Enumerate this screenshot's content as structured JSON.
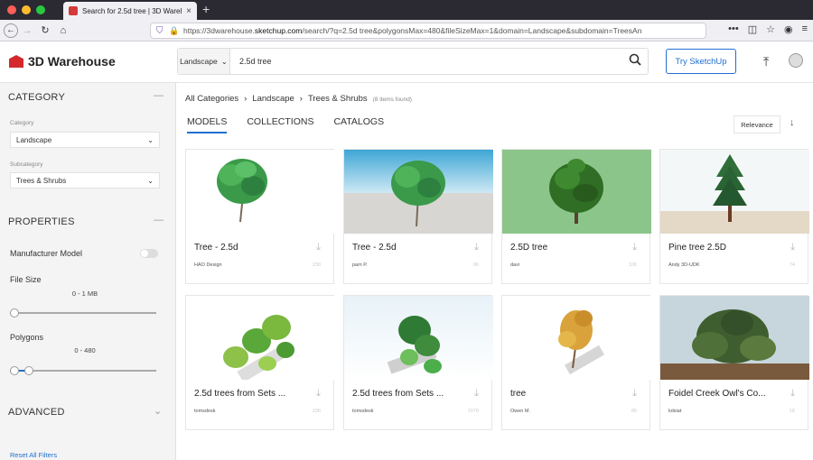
{
  "browser": {
    "tab_title": "Search for 2.5d tree | 3D Wareh",
    "url_prefix": "https://3dwarehouse.",
    "url_domain": "sketchup.com",
    "url_suffix": "/search/?q=2.5d tree&polygonsMax=480&fileSizeMax=1&domain=Landscape&subdomain=TreesAn"
  },
  "header": {
    "logo_text": "3D Warehouse",
    "search_category": "Landscape",
    "search_value": "2.5d tree",
    "try_label": "Try SketchUp"
  },
  "sidebar": {
    "category_title": "CATEGORY",
    "category_label": "Category",
    "category_value": "Landscape",
    "subcategory_label": "Subcategory",
    "subcategory_value": "Trees & Shrubs",
    "properties_title": "PROPERTIES",
    "manufacturer_label": "Manufacturer Model",
    "filesize_label": "File Size",
    "filesize_range": "0 - 1 MB",
    "polygons_label": "Polygons",
    "polygons_range": "0 - 480",
    "advanced_title": "ADVANCED",
    "reset_label": "Reset All Filters"
  },
  "breadcrumb": {
    "items": [
      "All Categories",
      "Landscape",
      "Trees & Shrubs"
    ],
    "found": "(8 items found)"
  },
  "tabs": [
    "MODELS",
    "COLLECTIONS",
    "CATALOGS"
  ],
  "sort_label": "Relevance",
  "colors": {
    "accent": "#1f6fd1",
    "brand_red": "#d4282c"
  },
  "cards": [
    {
      "title": "Tree - 2.5d",
      "author": "HAO Design",
      "count": "230"
    },
    {
      "title": "Tree - 2.5d",
      "author": "pam P.",
      "count": "96"
    },
    {
      "title": "2.5D tree",
      "author": "davi",
      "count": "106"
    },
    {
      "title": "Pine tree 2.5D",
      "author": "Andy 3D-UDK",
      "count": "74"
    },
    {
      "title": "2.5d trees from Sets ...",
      "author": "tomsdesk",
      "count": "196"
    },
    {
      "title": "2.5d trees from Sets ...",
      "author": "tomsdesk",
      "count": "1070"
    },
    {
      "title": "tree",
      "author": "Owen M.",
      "count": "86"
    },
    {
      "title": "Foidel Creek Owl's Co...",
      "author": "kdsiat",
      "count": "18"
    }
  ]
}
